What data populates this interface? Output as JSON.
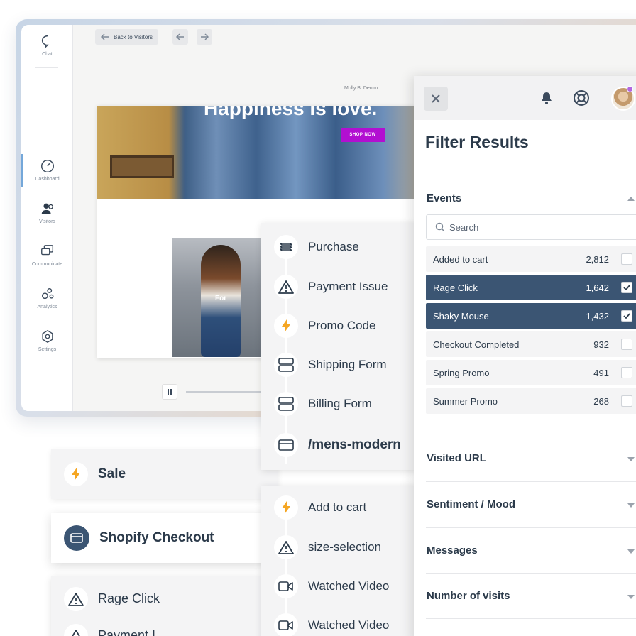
{
  "sidenav": {
    "chat": "Chat",
    "dashboard": "Dashboard",
    "visitors": "Visitors",
    "communicate": "Communicate",
    "analytics": "Analytics",
    "settings": "Settings"
  },
  "replay": {
    "back_label": "Back to Visitors",
    "site_brand": "Molly B. Denim",
    "hero_headline": "Happiness is love.",
    "shop_now": "SHOP NOW",
    "product_tag": "For"
  },
  "event_list_top": [
    {
      "label": "Purchase",
      "icon": "layers-icon"
    },
    {
      "label": "Payment Issue",
      "icon": "warning-icon"
    },
    {
      "label": "Promo Code",
      "icon": "bolt-icon"
    },
    {
      "label": "Shipping Form",
      "icon": "form-icon"
    },
    {
      "label": "Billing Form",
      "icon": "form-icon"
    },
    {
      "label": "/mens-modern",
      "icon": "card-icon"
    }
  ],
  "event_list_bottom": [
    {
      "label": "Add to cart",
      "icon": "bolt-icon"
    },
    {
      "label": "size-selection",
      "icon": "warning-icon"
    },
    {
      "label": "Watched Video",
      "icon": "video-icon"
    },
    {
      "label": "Watched Video",
      "icon": "video-icon"
    }
  ],
  "cards": {
    "sale": "Sale",
    "shopify_checkout": "Shopify Checkout",
    "rage_click": "Rage Click",
    "partial": "Payment I"
  },
  "filter": {
    "title": "Filter Results",
    "events_label": "Events",
    "search_placeholder": "Search",
    "rows": [
      {
        "label": "Added to cart",
        "count": "2,812",
        "checked": false
      },
      {
        "label": "Rage Click",
        "count": "1,642",
        "checked": true
      },
      {
        "label": "Shaky Mouse",
        "count": "1,432",
        "checked": true
      },
      {
        "label": "Checkout Completed",
        "count": "932",
        "checked": false
      },
      {
        "label": "Spring Promo",
        "count": "491",
        "checked": false
      },
      {
        "label": "Summer Promo",
        "count": "268",
        "checked": false
      }
    ],
    "sections": [
      "Visited URL",
      "Sentiment / Mood",
      "Messages",
      "Number of visits"
    ]
  },
  "colors": {
    "navy": "#3b5573",
    "bolt": "#f5a623",
    "shop_now": "#b20fd1",
    "avatar_dot": "#b267e0"
  }
}
